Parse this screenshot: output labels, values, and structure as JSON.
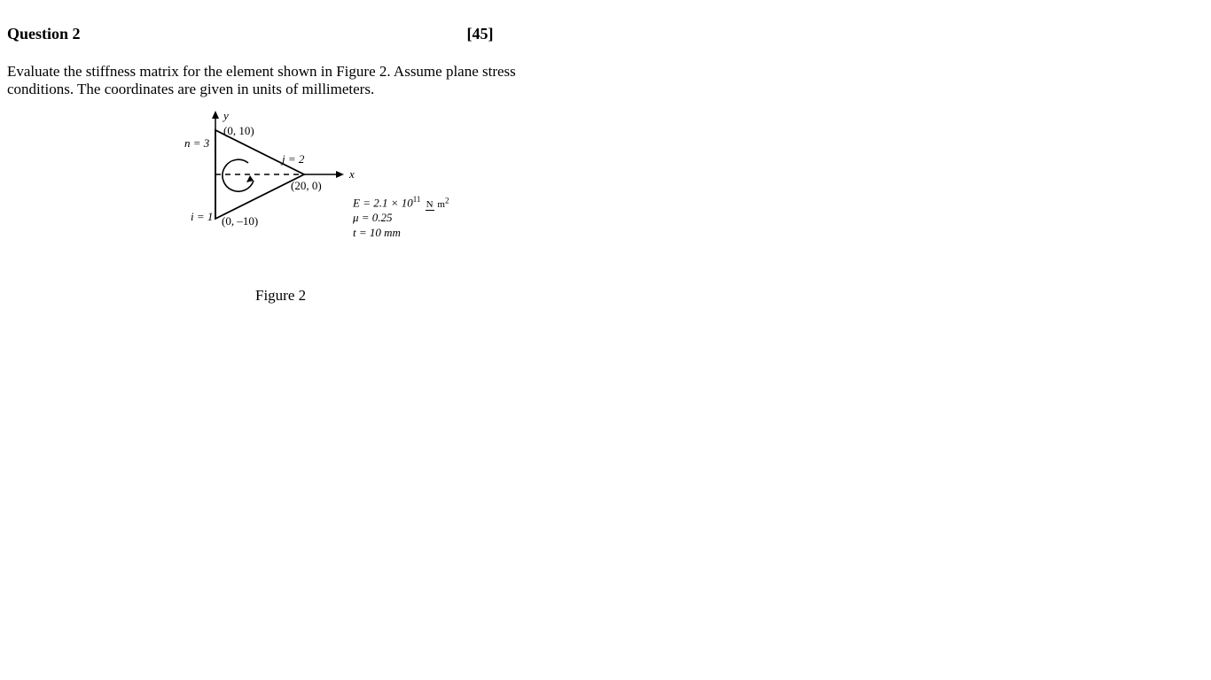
{
  "header": {
    "title": "Question 2",
    "marks": "[45]"
  },
  "body": {
    "line1": "Evaluate the stiffness matrix for the element shown in Figure 2. Assume plane stress",
    "line2": "conditions. The coordinates are given in units of millimeters."
  },
  "figure": {
    "y_axis": "y",
    "x_axis": "x",
    "node_n": "n = 3",
    "node_j": "j = 2",
    "node_i": "i = 1",
    "coord_top": "(0, 10)",
    "coord_right": "(20, 0)",
    "coord_bottom": "(0, –10)",
    "E_label": "E = 2.1 × 10",
    "E_exp": "11",
    "E_unit_num": "N",
    "E_unit_den": "m",
    "E_unit_den_exp": "2",
    "mu": "μ = 0.25",
    "t": "t = 10 mm",
    "caption": "Figure 2"
  }
}
